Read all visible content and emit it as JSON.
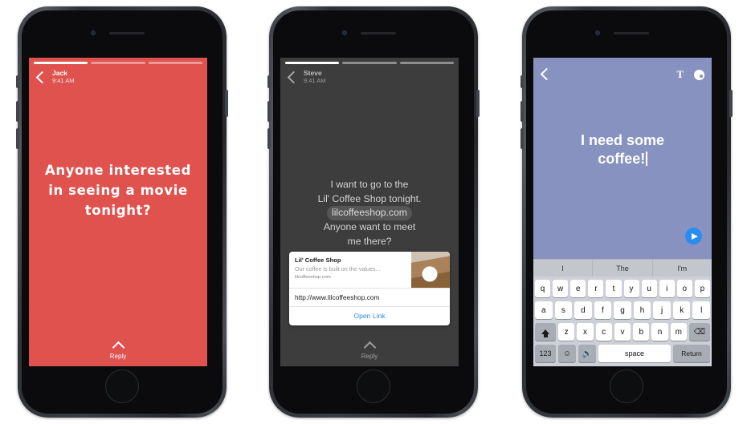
{
  "colors": {
    "screen1_bg": "#e0524e",
    "screen2_bg": "#3d3d3d",
    "screen3_bg": "#8892c0",
    "accent_link": "#2a8cf0"
  },
  "screens": [
    {
      "id": "chat-red",
      "header": {
        "name": "Jack",
        "time": "9:41 AM",
        "back_icon": "chevron-left-icon"
      },
      "progress": {
        "segments": 3,
        "active_index": 0
      },
      "message": "Anyone interested in seeing a movie tonight?",
      "footer": {
        "label": "Reply",
        "icon": "chevron-up-icon"
      }
    },
    {
      "id": "chat-gray",
      "header": {
        "name": "Steve",
        "time": "9:41 AM",
        "back_icon": "chevron-left-icon"
      },
      "progress": {
        "segments": 3,
        "active_index": 0
      },
      "message_line1": "I want to go to the",
      "message_line2": "Lil' Coffee Shop tonight.",
      "message_url": "lilcoffeeshop.com",
      "message_line3": "Anyone want to meet",
      "message_line4": "me there?",
      "card": {
        "title": "Lil' Coffee Shop",
        "description": "Our coffee is built on the values...",
        "domain": "lilcoffeeshop.com",
        "url": "http://www.lilcoffeeshop.com",
        "open_label": "Open Link",
        "thumbnail": "coffee-cup-photo"
      },
      "footer": {
        "label": "Reply",
        "icon": "chevron-up-icon"
      }
    },
    {
      "id": "compose-periwinkle",
      "header": {
        "back_icon": "chevron-left-icon",
        "text_tool_label": "T",
        "text_tool_icon": "text-tool-icon",
        "color_tool_icon": "palette-icon"
      },
      "compose_line1": "I need some",
      "compose_line2": "coffee!",
      "send_icon": "send-icon",
      "keyboard": {
        "predictions": [
          "I",
          "The",
          "I'm"
        ],
        "row1": [
          "q",
          "w",
          "e",
          "r",
          "t",
          "y",
          "u",
          "i",
          "o",
          "p"
        ],
        "row2": [
          "a",
          "s",
          "d",
          "f",
          "g",
          "h",
          "j",
          "k",
          "l"
        ],
        "row3": [
          "z",
          "x",
          "c",
          "v",
          "b",
          "n",
          "m"
        ],
        "shift_icon": "shift-icon",
        "delete_icon": "backspace-icon",
        "numeric_label": "123",
        "emoji_icon": "emoji-icon",
        "mic_icon": "microphone-icon",
        "space_label": "space",
        "return_label": "Return"
      }
    }
  ]
}
